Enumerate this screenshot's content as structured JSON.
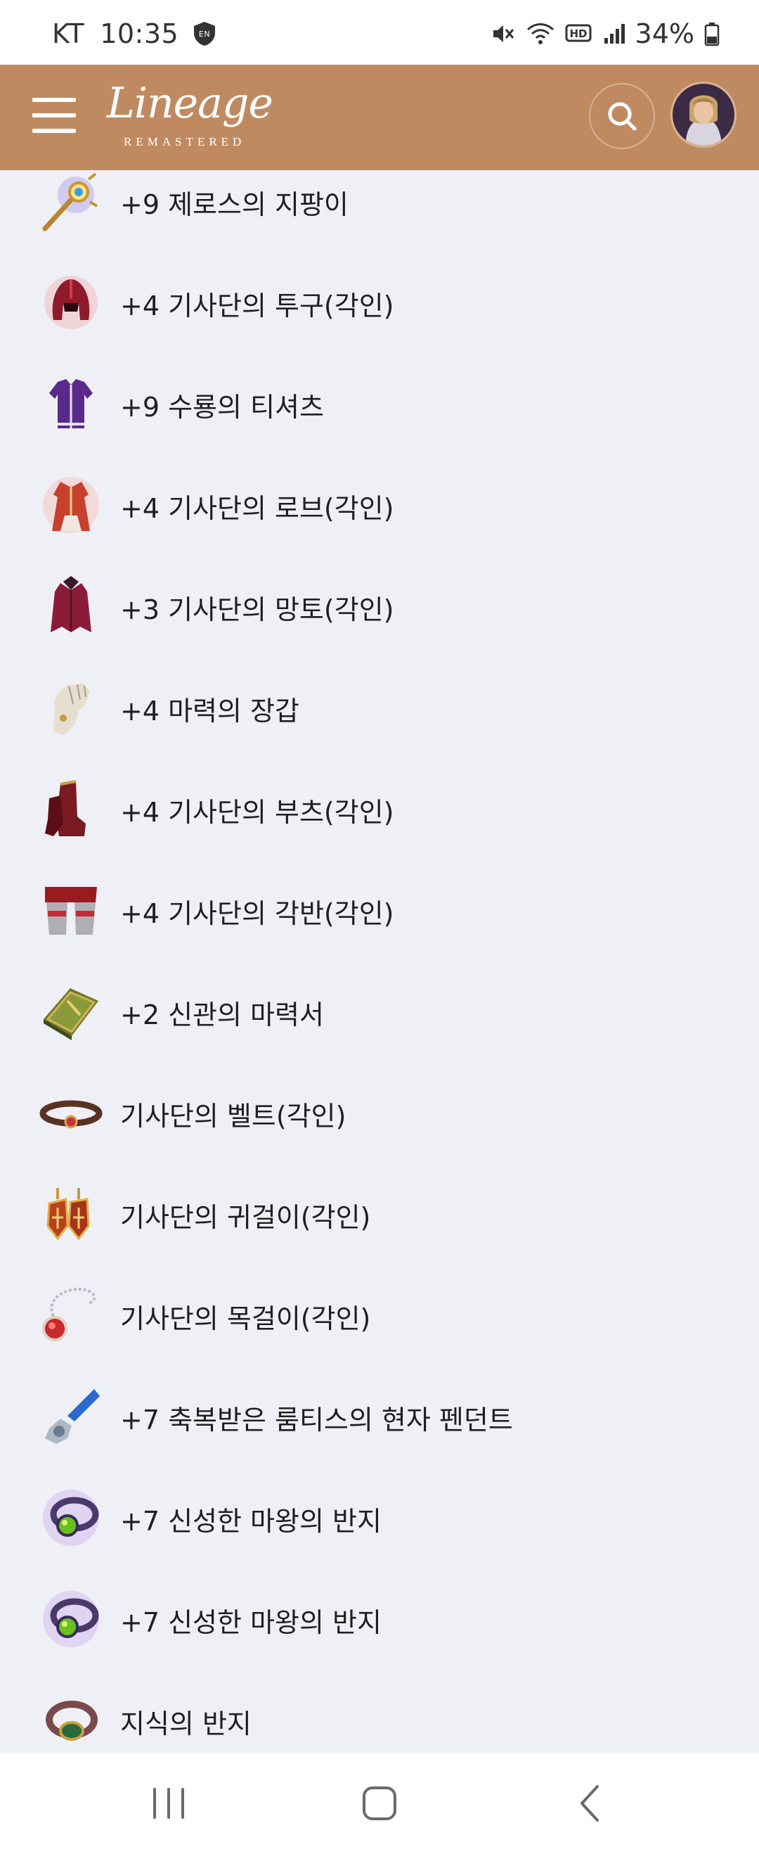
{
  "status_bar": {
    "carrier": "KT",
    "time": "10:35",
    "battery": "34%"
  },
  "header": {
    "logo_text": "Lineage",
    "logo_subtext": "REMASTERED"
  },
  "items": [
    {
      "label": "+9 제로스의 지팡이",
      "icon": "staff-icon"
    },
    {
      "label": "+4 기사단의 투구(각인)",
      "icon": "helmet-icon"
    },
    {
      "label": "+9 수룡의 티셔츠",
      "icon": "shirt-icon"
    },
    {
      "label": "+4 기사단의 로브(각인)",
      "icon": "robe-icon"
    },
    {
      "label": "+3 기사단의 망토(각인)",
      "icon": "cloak-icon"
    },
    {
      "label": "+4 마력의 장갑",
      "icon": "gloves-icon"
    },
    {
      "label": "+4 기사단의 부츠(각인)",
      "icon": "boots-icon"
    },
    {
      "label": "+4 기사단의 각반(각인)",
      "icon": "greaves-icon"
    },
    {
      "label": "+2 신관의 마력서",
      "icon": "spellbook-icon"
    },
    {
      "label": "기사단의 벨트(각인)",
      "icon": "belt-icon"
    },
    {
      "label": "기사단의 귀걸이(각인)",
      "icon": "earring-icon"
    },
    {
      "label": "기사단의 목걸이(각인)",
      "icon": "necklace-icon"
    },
    {
      "label": "+7 축복받은 룸티스의 현자 펜던트",
      "icon": "pendant-icon"
    },
    {
      "label": "+7 신성한 마왕의 반지",
      "icon": "ring-icon"
    },
    {
      "label": "+7 신성한 마왕의 반지",
      "icon": "ring-icon"
    },
    {
      "label": "지식의 반지",
      "icon": "ring-icon"
    }
  ],
  "colors": {
    "header_bg": "#c08a61",
    "list_bg": "#eff0f5"
  }
}
